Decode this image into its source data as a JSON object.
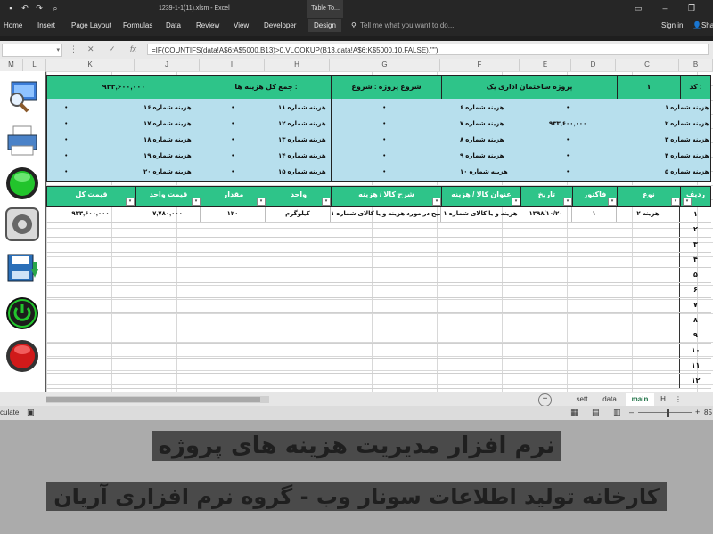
{
  "window": {
    "file_title": "1239-1-1(11).xlsm - Excel",
    "context_tab": "Table To...",
    "sign_in": "Sign in",
    "share": "Sha"
  },
  "ribbon_tabs": [
    "Home",
    "Insert",
    "Page Layout",
    "Formulas",
    "Data",
    "Review",
    "View",
    "Developer",
    "Design"
  ],
  "tell_me": "Tell me what you want to do...",
  "formula_bar": {
    "formula": "=IF(COUNTIFS(data!A$6:A$5000,B13)>0,VLOOKUP(B13,data!A$6:K$5000,10,FALSE),\"\")",
    "fx": "fx"
  },
  "columns": [
    "M",
    "L",
    "K",
    "J",
    "I",
    "H",
    "G",
    "F",
    "E",
    "D",
    "C",
    "B"
  ],
  "summary": {
    "code_label": "کد :",
    "code_value": "۱",
    "project_name": "پروژه ساختمان اداری یک",
    "start_label": "شروع پروژه : شروع",
    "total_label": "جمع کل هزینه ها :",
    "total_value": "۹۳۳,۶۰۰,۰۰۰",
    "dot": "•",
    "col1": [
      {
        "label": "هزینه شماره ۱",
        "value": "•"
      },
      {
        "label": "هزینه شماره ۲",
        "value": "۹۳۳,۶۰۰,۰۰۰"
      },
      {
        "label": "هزینه شماره ۳",
        "value": "•"
      },
      {
        "label": "هزینه شماره ۴",
        "value": "•"
      },
      {
        "label": "هزینه شماره ۵",
        "value": "•"
      }
    ],
    "col2": [
      {
        "label": "هزینه شماره ۶",
        "value": "•"
      },
      {
        "label": "هزینه شماره ۷",
        "value": "•"
      },
      {
        "label": "هزینه شماره ۸",
        "value": "•"
      },
      {
        "label": "هزینه شماره ۹",
        "value": "•"
      },
      {
        "label": "هزینه شماره ۱۰",
        "value": "•"
      }
    ],
    "col3": [
      {
        "label": "هزینه شماره ۱۱",
        "value": "•"
      },
      {
        "label": "هزینه شماره ۱۲",
        "value": "•"
      },
      {
        "label": "هزینه شماره ۱۳",
        "value": "•"
      },
      {
        "label": "هزینه شماره ۱۴",
        "value": "•"
      },
      {
        "label": "هزینه شماره ۱۵",
        "value": "•"
      }
    ],
    "col4": [
      {
        "label": "هزینه شماره ۱۶",
        "value": "•"
      },
      {
        "label": "هزینه شماره ۱۷",
        "value": "•"
      },
      {
        "label": "هزینه شماره ۱۸",
        "value": "•"
      },
      {
        "label": "هزینه شماره ۱۹",
        "value": "•"
      },
      {
        "label": "هزینه شماره ۲۰",
        "value": "•"
      }
    ]
  },
  "table": {
    "headers": [
      "قیمت کل",
      "قیمت واحد",
      "مقدار",
      "واحد",
      "شرح کالا / هزینه",
      "عنوان کالا / هزینه",
      "تاریخ",
      "فاکتور",
      "نوع",
      "ردیف"
    ],
    "row1": [
      "۹۳۳,۶۰۰,۰۰۰",
      "۷,۷۸۰,۰۰۰",
      "۱۲۰",
      "کیلوگرم",
      "توضیح در مورد هزینه و یا کالای شماره ۱",
      "هزینه و یا کالای شماره ۱",
      "۱۳۹۸/۱۰/۲۰",
      "۱",
      "هزینه ۲"
    ],
    "row_numbers": [
      "۱",
      "۲",
      "۳",
      "۴",
      "۵",
      "۶",
      "۷",
      "۸",
      "۹",
      "۱۰",
      "۱۱",
      "۱۲"
    ]
  },
  "sheet_tabs": [
    "sett",
    "data",
    "main",
    "H"
  ],
  "status_text": "culate",
  "zoom": "85",
  "banner": {
    "line1": "نرم افزار مدیریت هزینه های پروژه",
    "line2": "کارخانه تولید اطلاعات سونار وب - گروه نرم افزاری آریان"
  },
  "colors": {
    "header_green": "#2ec489",
    "summary_blue": "#b7dfed",
    "ribbon_dark": "#262626"
  }
}
